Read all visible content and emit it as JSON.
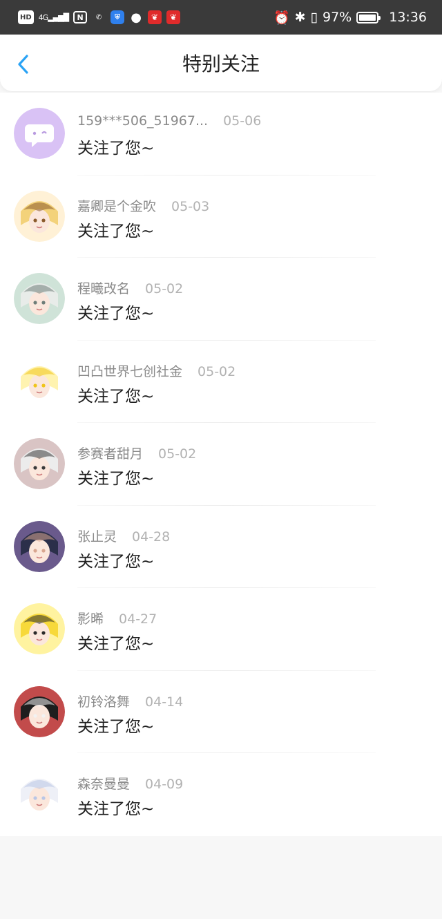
{
  "status_bar": {
    "left_icons": [
      "hd-icon",
      "4g-signal-icon",
      "nfc-icon",
      "missed-call-icon",
      "shield-icon",
      "chat-icon",
      "app-notification-icon",
      "app-notification-icon"
    ],
    "hd": "HD",
    "network": "4G",
    "battery_percent": "97%",
    "battery_level": 0.97,
    "time": "13:36"
  },
  "header": {
    "title": "特别关注"
  },
  "accent_color": "#2aa3f5",
  "items": [
    {
      "name": "159***506_51967...",
      "date": "05-06",
      "message": "关注了您~",
      "avatar": "default-chat-avatar"
    },
    {
      "name": "嘉卿是个金吹",
      "date": "05-03",
      "message": "关注了您~",
      "avatar": "anime-avatar"
    },
    {
      "name": "程曦改名",
      "date": "05-02",
      "message": "关注了您~",
      "avatar": "anime-avatar"
    },
    {
      "name": "凹凸世界七创社金",
      "date": "05-02",
      "message": "关注了您~",
      "avatar": "anime-avatar"
    },
    {
      "name": "参赛者甜月",
      "date": "05-02",
      "message": "关注了您~",
      "avatar": "anime-avatar"
    },
    {
      "name": "张止灵",
      "date": "04-28",
      "message": "关注了您~",
      "avatar": "anime-avatar"
    },
    {
      "name": "影晞",
      "date": "04-27",
      "message": "关注了您~",
      "avatar": "anime-avatar"
    },
    {
      "name": "初铃洛舞",
      "date": "04-14",
      "message": "关注了您~",
      "avatar": "anime-avatar"
    },
    {
      "name": "森奈曼曼",
      "date": "04-09",
      "message": "关注了您~",
      "avatar": "anime-avatar"
    }
  ]
}
